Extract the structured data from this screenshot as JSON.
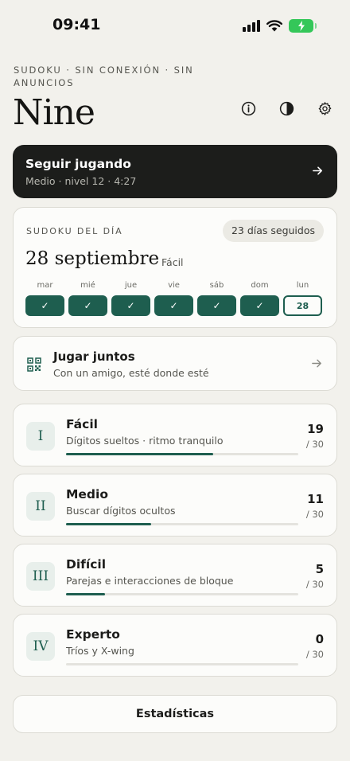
{
  "status_bar": {
    "time": "09:41"
  },
  "header": {
    "tagline": "SUDOKU · SIN CONEXIÓN · SIN ANUNCIOS",
    "brand": "Nine"
  },
  "icons": {
    "info": "info-icon",
    "theme": "contrast-icon",
    "settings": "gear-icon"
  },
  "continue_card": {
    "title": "Seguir jugando",
    "subtitle": "Medio · nivel 12 · 4:27"
  },
  "daily": {
    "label": "SUDOKU DEL DÍA",
    "streak": "23 días seguidos",
    "date": "28 septiembre",
    "difficulty": "Fácil",
    "week": [
      {
        "day": "mar",
        "mark": "✓"
      },
      {
        "day": "mié",
        "mark": "✓"
      },
      {
        "day": "jue",
        "mark": "✓"
      },
      {
        "day": "vie",
        "mark": "✓"
      },
      {
        "day": "sáb",
        "mark": "✓"
      },
      {
        "day": "dom",
        "mark": "✓"
      },
      {
        "day": "lun",
        "mark": "28"
      }
    ]
  },
  "together": {
    "title": "Jugar juntos",
    "subtitle": "Con un amigo, esté donde esté"
  },
  "levels": [
    {
      "numeral": "I",
      "name": "Fácil",
      "desc": "Dígitos sueltos · ritmo tranquilo",
      "count": "19",
      "total": "/ 30",
      "progress": 0.633
    },
    {
      "numeral": "II",
      "name": "Medio",
      "desc": "Buscar dígitos ocultos",
      "count": "11",
      "total": "/ 30",
      "progress": 0.367
    },
    {
      "numeral": "III",
      "name": "Difícil",
      "desc": "Parejas e interacciones de bloque",
      "count": "5",
      "total": "/ 30",
      "progress": 0.167
    },
    {
      "numeral": "IV",
      "name": "Experto",
      "desc": "Tríos y X-wing",
      "count": "0",
      "total": "/ 30",
      "progress": 0
    }
  ],
  "stats_button": "Estadísticas",
  "colors": {
    "accent": "#1e5e4f",
    "background": "#f2f1ec",
    "dark_card": "#1c1d1b",
    "battery": "#34c759"
  }
}
